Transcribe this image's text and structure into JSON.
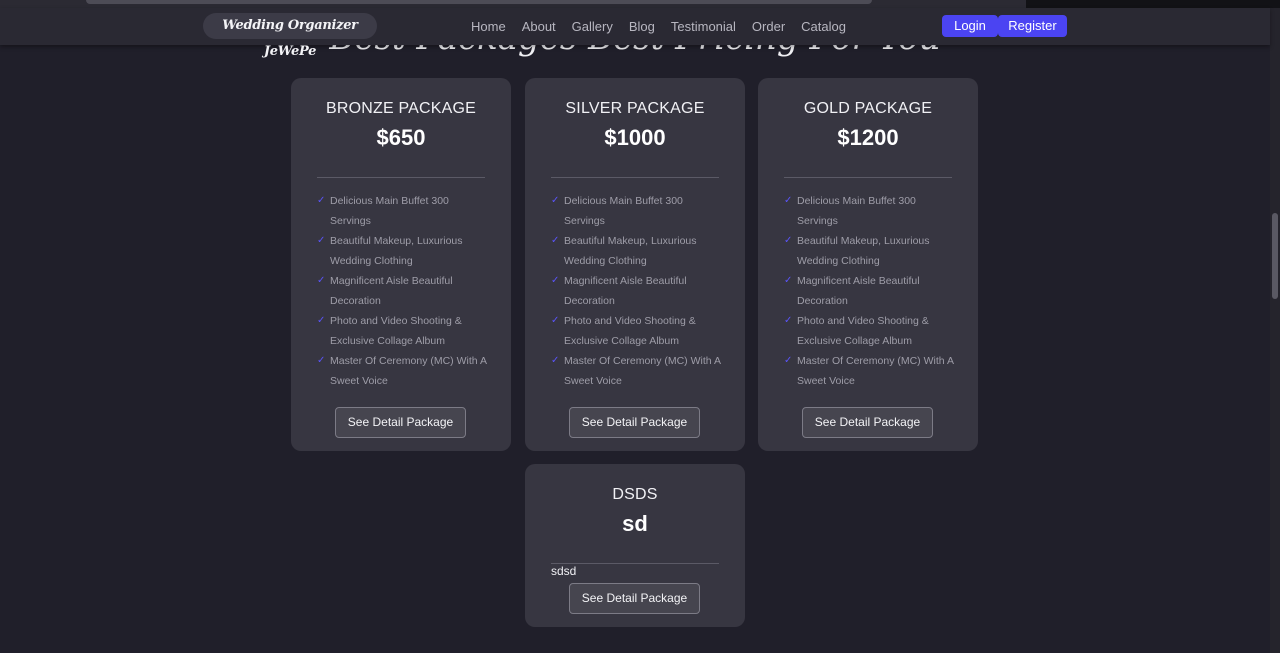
{
  "navbar": {
    "brand": "Wedding Organizer JeWePe",
    "links": [
      "Home",
      "About",
      "Gallery",
      "Blog",
      "Testimonial",
      "Order",
      "Catalog"
    ],
    "login_label": "Login",
    "register_label": "Register"
  },
  "section": {
    "heading": "Best Packages Best Pricing For You"
  },
  "packages": [
    {
      "title": "BRONZE PACKAGE",
      "price": "$650",
      "features": [
        "Delicious Main Buffet 300 Servings",
        "Beautiful Makeup, Luxurious Wedding Clothing",
        "Magnificent Aisle Beautiful Decoration",
        "Photo and Video Shooting & Exclusive Collage Album",
        "Master Of Ceremony (MC) With A Sweet Voice"
      ],
      "button_label": "See Detail Package"
    },
    {
      "title": "SILVER PACKAGE",
      "price": "$1000",
      "features": [
        "Delicious Main Buffet 300 Servings",
        "Beautiful Makeup, Luxurious Wedding Clothing",
        "Magnificent Aisle Beautiful Decoration",
        "Photo and Video Shooting & Exclusive Collage Album",
        "Master Of Ceremony (MC) With A Sweet Voice"
      ],
      "button_label": "See Detail Package"
    },
    {
      "title": "GOLD PACKAGE",
      "price": "$1200",
      "features": [
        "Delicious Main Buffet 300 Servings",
        "Beautiful Makeup, Luxurious Wedding Clothing",
        "Magnificent Aisle Beautiful Decoration",
        "Photo and Video Shooting & Exclusive Collage Album",
        "Master Of Ceremony (MC) With A Sweet Voice"
      ],
      "button_label": "See Detail Package"
    },
    {
      "title": "DSDS",
      "price": "sd",
      "description": "sdsd",
      "button_label": "See Detail Package"
    }
  ],
  "icons": {
    "check": "check-icon"
  },
  "colors": {
    "accent": "#4b44f2",
    "background": "#201f2a",
    "card": "#373641",
    "navbar": "#2a2933"
  }
}
